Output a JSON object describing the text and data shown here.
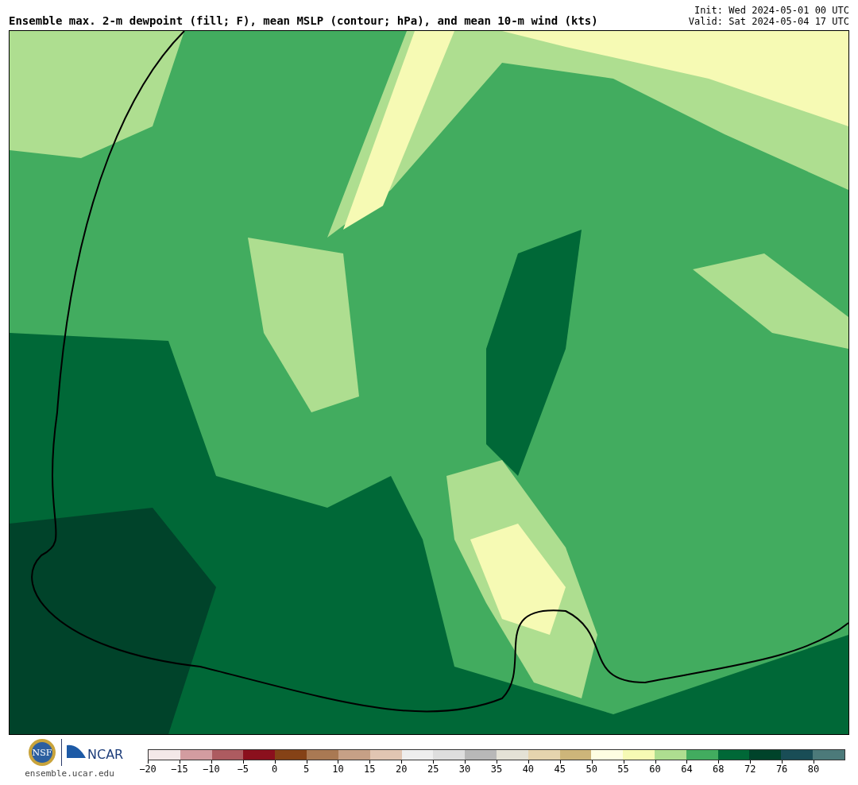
{
  "header": {
    "title": "Ensemble max. 2-m dewpoint (fill; F), mean MSLP (contour; hPa), and mean 10-m wind (kts)",
    "init": "Init: Wed 2024-05-01 00 UTC",
    "valid": "Valid: Sat 2024-05-04 17 UTC"
  },
  "footer": {
    "nsf_logo_text": "NSF",
    "ncar_logo_text": "NCAR",
    "url": "ensemble.ucar.edu"
  },
  "colorbar": {
    "segments": [
      {
        "color": "#f3e8e8"
      },
      {
        "color": "#d39ca0"
      },
      {
        "color": "#ad5b60"
      },
      {
        "color": "#8b101d"
      },
      {
        "color": "#854216"
      },
      {
        "color": "#a97953"
      },
      {
        "color": "#c6a086"
      },
      {
        "color": "#e1c5b2"
      },
      {
        "color": "#eeeeee"
      },
      {
        "color": "#dedede"
      },
      {
        "color": "#b8b8b8"
      },
      {
        "color": "#e4e2d6"
      },
      {
        "color": "#e5d4ae"
      },
      {
        "color": "#cdb57a"
      },
      {
        "color": "#fefde2"
      },
      {
        "color": "#f6fab4"
      },
      {
        "color": "#aede90"
      },
      {
        "color": "#42ac5f"
      },
      {
        "color": "#006837"
      },
      {
        "color": "#00432a"
      },
      {
        "color": "#194d56"
      },
      {
        "color": "#4c7a7a"
      }
    ],
    "ticks": [
      "−20",
      "−15",
      "−10",
      "−5",
      "0",
      "5",
      "10",
      "15",
      "20",
      "25",
      "30",
      "35",
      "40",
      "45",
      "50",
      "55",
      "60",
      "64",
      "68",
      "72",
      "76",
      "80"
    ]
  }
}
